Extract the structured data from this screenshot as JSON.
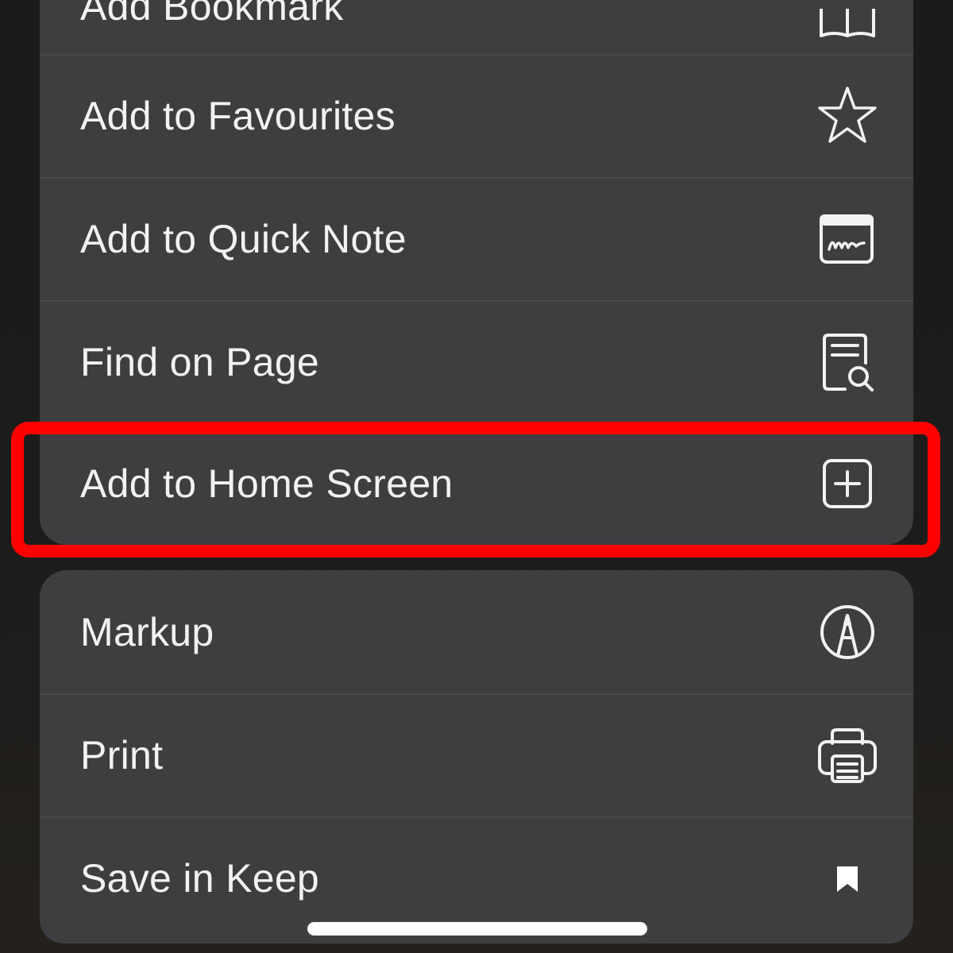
{
  "menu_top": {
    "items": [
      {
        "label": "Add Bookmark",
        "icon": "book-icon"
      },
      {
        "label": "Add to Favourites",
        "icon": "star-icon"
      },
      {
        "label": "Add to Quick Note",
        "icon": "quick-note-icon"
      },
      {
        "label": "Find on Page",
        "icon": "find-on-page-icon"
      },
      {
        "label": "Add to Home Screen",
        "icon": "plus-square-icon",
        "highlighted": true
      }
    ]
  },
  "menu_bottom": {
    "items": [
      {
        "label": "Markup",
        "icon": "markup-pen-icon"
      },
      {
        "label": "Print",
        "icon": "printer-icon"
      },
      {
        "label": "Save in Keep",
        "icon": "bookmark-icon"
      }
    ]
  },
  "colors": {
    "highlight": "#ff0000",
    "menu_background": "#3e3e40",
    "text": "#f2f2f2"
  }
}
